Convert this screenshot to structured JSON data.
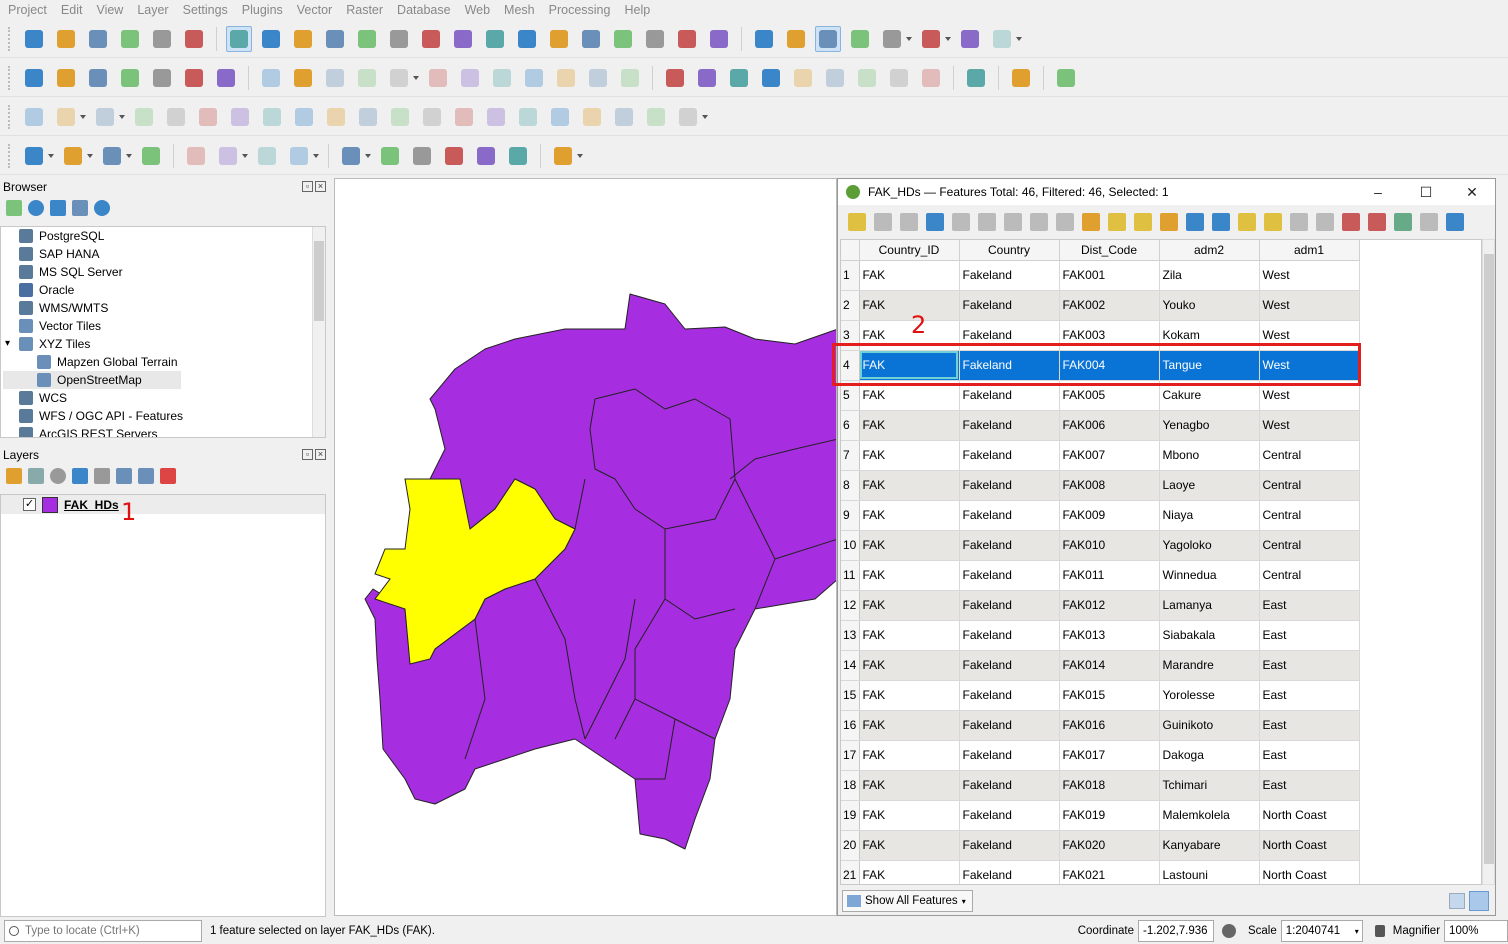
{
  "menubar": [
    "Project",
    "Edit",
    "View",
    "Layer",
    "Settings",
    "Plugins",
    "Vector",
    "Raster",
    "Database",
    "Web",
    "Mesh",
    "Processing",
    "Help"
  ],
  "browser": {
    "title": "Browser",
    "items": [
      {
        "label": "PostgreSQL",
        "indent": 0,
        "icon": "elephant-icon"
      },
      {
        "label": "SAP HANA",
        "indent": 0,
        "icon": "database-icon"
      },
      {
        "label": "MS SQL Server",
        "indent": 0,
        "icon": "sqlserver-icon"
      },
      {
        "label": "Oracle",
        "indent": 0,
        "icon": "oracle-icon"
      },
      {
        "label": "WMS/WMTS",
        "indent": 0,
        "icon": "globe-icon"
      },
      {
        "label": "Vector Tiles",
        "indent": 0,
        "icon": "grid-icon"
      },
      {
        "label": "XYZ Tiles",
        "indent": 0,
        "icon": "grid-icon"
      },
      {
        "label": "Mapzen Global Terrain",
        "indent": 1,
        "icon": "grid-icon"
      },
      {
        "label": "OpenStreetMap",
        "indent": 1,
        "icon": "grid-icon"
      },
      {
        "label": "WCS",
        "indent": 0,
        "icon": "globe-icon"
      },
      {
        "label": "WFS / OGC API - Features",
        "indent": 0,
        "icon": "globe-icon"
      },
      {
        "label": "ArcGIS REST Servers",
        "indent": 0,
        "icon": "globe-icon"
      }
    ]
  },
  "layers": {
    "title": "Layers",
    "items": [
      {
        "label": "FAK_HDs",
        "checked": true,
        "color": "#a62ee0"
      }
    ]
  },
  "annotations": {
    "one": "1",
    "two": "2"
  },
  "attribute_table": {
    "title": "FAK_HDs — Features Total: 46, Filtered: 46, Selected: 1",
    "columns": [
      "Country_ID",
      "Country",
      "Dist_Code",
      "adm2",
      "adm1"
    ],
    "rows": [
      [
        "1",
        "FAK",
        "Fakeland",
        "FAK001",
        "Zila",
        "West"
      ],
      [
        "2",
        "FAK",
        "Fakeland",
        "FAK002",
        "Youko",
        "West"
      ],
      [
        "3",
        "FAK",
        "Fakeland",
        "FAK003",
        "Kokam",
        "West"
      ],
      [
        "4",
        "FAK",
        "Fakeland",
        "FAK004",
        "Tangue",
        "West"
      ],
      [
        "5",
        "FAK",
        "Fakeland",
        "FAK005",
        "Cakure",
        "West"
      ],
      [
        "6",
        "FAK",
        "Fakeland",
        "FAK006",
        "Yenagbo",
        "West"
      ],
      [
        "7",
        "FAK",
        "Fakeland",
        "FAK007",
        "Mbono",
        "Central"
      ],
      [
        "8",
        "FAK",
        "Fakeland",
        "FAK008",
        "Laoye",
        "Central"
      ],
      [
        "9",
        "FAK",
        "Fakeland",
        "FAK009",
        "Niaya",
        "Central"
      ],
      [
        "10",
        "FAK",
        "Fakeland",
        "FAK010",
        "Yagoloko",
        "Central"
      ],
      [
        "11",
        "FAK",
        "Fakeland",
        "FAK011",
        "Winnedua",
        "Central"
      ],
      [
        "12",
        "FAK",
        "Fakeland",
        "FAK012",
        "Lamanya",
        "East"
      ],
      [
        "13",
        "FAK",
        "Fakeland",
        "FAK013",
        "Siabakala",
        "East"
      ],
      [
        "14",
        "FAK",
        "Fakeland",
        "FAK014",
        "Marandre",
        "East"
      ],
      [
        "15",
        "FAK",
        "Fakeland",
        "FAK015",
        "Yorolesse",
        "East"
      ],
      [
        "16",
        "FAK",
        "Fakeland",
        "FAK016",
        "Guinikoto",
        "East"
      ],
      [
        "17",
        "FAK",
        "Fakeland",
        "FAK017",
        "Dakoga",
        "East"
      ],
      [
        "18",
        "FAK",
        "Fakeland",
        "FAK018",
        "Tchimari",
        "East"
      ],
      [
        "19",
        "FAK",
        "Fakeland",
        "FAK019",
        "Malemkolela",
        "North Coast"
      ],
      [
        "20",
        "FAK",
        "Fakeland",
        "FAK020",
        "Kanyabare",
        "North Coast"
      ],
      [
        "21",
        "FAK",
        "Fakeland",
        "FAK021",
        "Lastouni",
        "North Coast"
      ]
    ],
    "selected_row": "4",
    "show_all_label": "Show All Features",
    "colors": {
      "selection": "#0a74d6",
      "alt_row": "#e8e6e2"
    }
  },
  "map": {
    "fill_color": "#a62ee0",
    "selected_color": "#ffff00"
  },
  "statusbar": {
    "locate_placeholder": "Type to locate (Ctrl+K)",
    "message": "1 feature selected on layer FAK_HDs (FAK).",
    "coordinate_label": "Coordinate",
    "coordinate_value": "-1.202,7.936",
    "scale_label": "Scale",
    "scale_value": "1:2040741",
    "magnifier_label": "Magnifier",
    "magnifier_value": "100%"
  }
}
